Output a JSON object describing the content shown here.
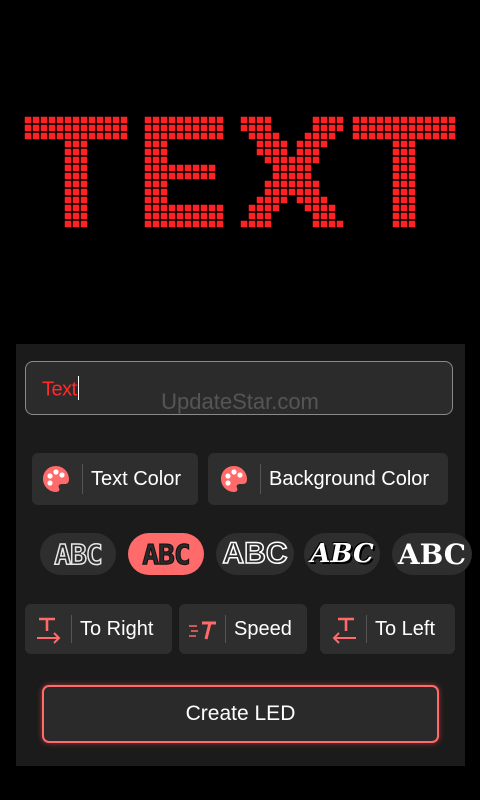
{
  "led_preview": {
    "text": "TEXT",
    "color": "#ff2222"
  },
  "input": {
    "value": "Text"
  },
  "watermark": "UpdateStar.com",
  "color_buttons": {
    "text_color_label": "Text Color",
    "background_color_label": "Background Color"
  },
  "font_styles": [
    {
      "sample": "ABC",
      "selected": false
    },
    {
      "sample": "ABC",
      "selected": true
    },
    {
      "sample": "ABC",
      "selected": false
    },
    {
      "sample": "ABC",
      "selected": false
    },
    {
      "sample": "ABC",
      "selected": false
    }
  ],
  "direction_buttons": {
    "to_right_label": "To Right",
    "speed_label": "Speed",
    "to_left_label": "To Left"
  },
  "create_button_label": "Create LED",
  "colors": {
    "accent": "#ff6a6a",
    "led_red": "#ff2222",
    "panel": "#1b1b1b",
    "chip": "#2e2e2e"
  }
}
